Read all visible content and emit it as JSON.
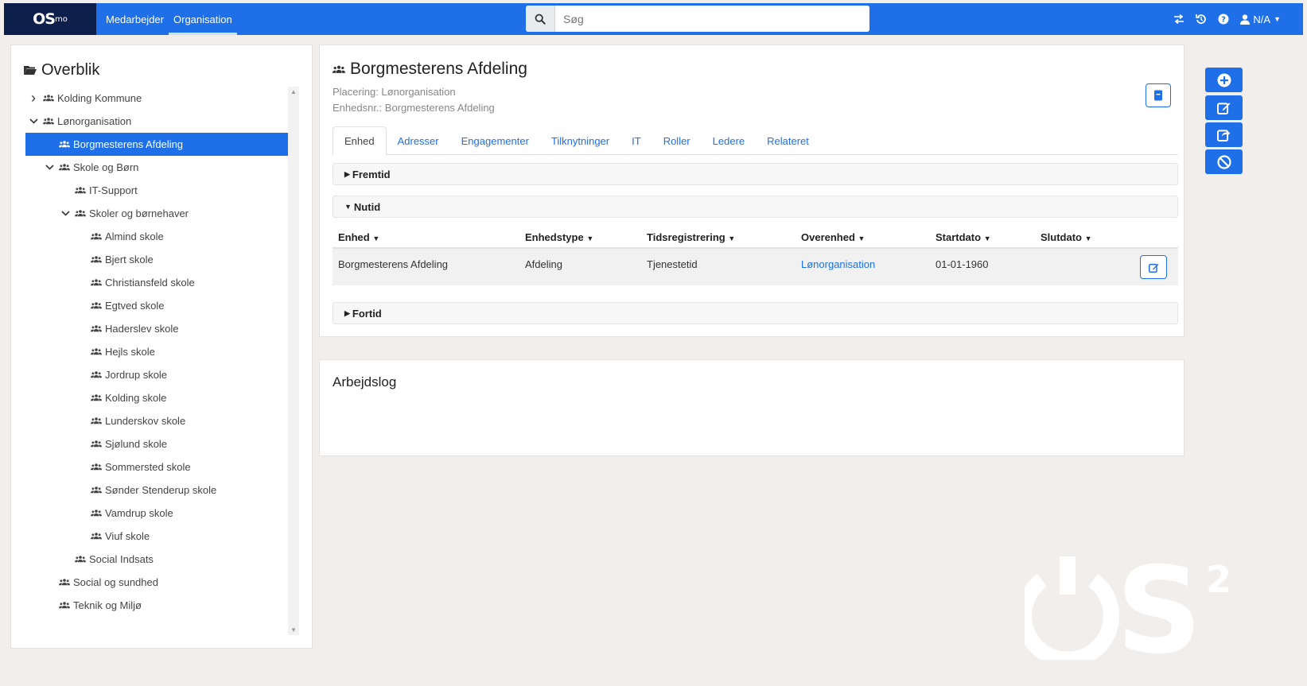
{
  "navbar": {
    "brand": "OS",
    "brand_sub": "mo",
    "links": [
      {
        "label": "Medarbejder",
        "active": false
      },
      {
        "label": "Organisation",
        "active": true
      }
    ],
    "search": {
      "placeholder": "Søg",
      "icon": "search-icon"
    },
    "user_label": "N/A",
    "icons": [
      "switch-icon",
      "history-icon",
      "help-icon",
      "user-icon"
    ]
  },
  "tree": {
    "title": "Overblik",
    "items": [
      {
        "label": "Kolding Kommune",
        "chevron": "collapsed"
      },
      {
        "label": "Lønorganisation",
        "chevron": "expanded"
      },
      {
        "label": "Borgmesterens Afdeling",
        "selected": true
      },
      {
        "label": "Skole og Børn",
        "chevron": "expanded"
      },
      {
        "label": "IT-Support"
      },
      {
        "label": "Skoler og børnehaver",
        "chevron": "expanded"
      },
      {
        "label": "Almind skole"
      },
      {
        "label": "Bjert skole"
      },
      {
        "label": "Christiansfeld skole"
      },
      {
        "label": "Egtved skole"
      },
      {
        "label": "Haderslev skole"
      },
      {
        "label": "Hejls skole"
      },
      {
        "label": "Jordrup skole"
      },
      {
        "label": "Kolding skole"
      },
      {
        "label": "Lunderskov skole"
      },
      {
        "label": "Sjølund skole"
      },
      {
        "label": "Sommersted skole"
      },
      {
        "label": "Sønder Stenderup skole"
      },
      {
        "label": "Vamdrup skole"
      },
      {
        "label": "Viuf skole"
      },
      {
        "label": "Social Indsats"
      },
      {
        "label": "Social og sundhed"
      },
      {
        "label": "Teknik og Miljø"
      }
    ]
  },
  "unit": {
    "title": "Borgmesterens Afdeling",
    "placering": "Placering: Lønorganisation",
    "enhedsnr": "Enhedsnr.: Borgmesterens Afdeling",
    "tabs": [
      {
        "label": "Enhed",
        "active": true
      },
      {
        "label": "Adresser"
      },
      {
        "label": "Engagementer"
      },
      {
        "label": "Tilknytninger"
      },
      {
        "label": "IT"
      },
      {
        "label": "Roller"
      },
      {
        "label": "Ledere"
      },
      {
        "label": "Relateret"
      }
    ],
    "sections": {
      "future": "Fremtid",
      "present": "Nutid",
      "past": "Fortid"
    },
    "table": {
      "headers": [
        "Enhed",
        "Enhedstype",
        "Tidsregistrering",
        "Overenhed",
        "Startdato",
        "Slutdato"
      ],
      "rows": [
        [
          "Borgmesterens Afdeling",
          "Afdeling",
          "Tjenestetid",
          "Lønorganisation",
          "01-01-1960",
          ""
        ]
      ]
    }
  },
  "worklog": {
    "title": "Arbejdslog"
  },
  "side_actions": [
    "plus-circle-icon",
    "edit-icon",
    "share-icon",
    "ban-icon"
  ],
  "colors": {
    "primary": "#1e6fe8",
    "brand_dark": "#0c1f4a",
    "background": "#f1eeec"
  }
}
